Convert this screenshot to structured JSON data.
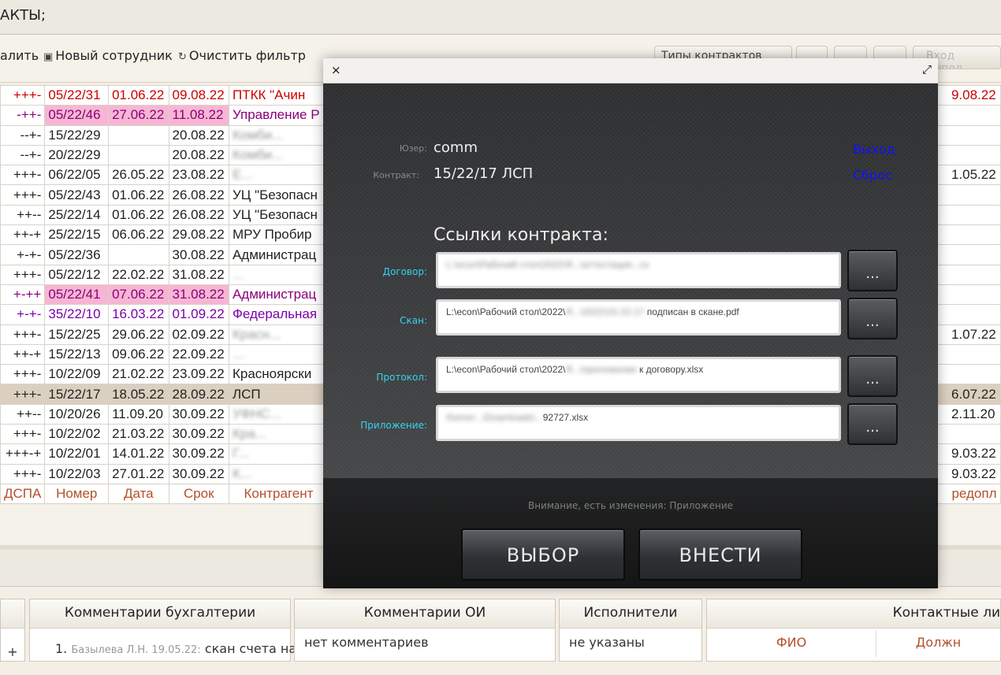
{
  "app": {
    "title": "АКТЫ;",
    "toolbar": {
      "delete_label": "алить",
      "new_employee_label": "Новый сотрудник",
      "clear_filter_label": "Очистить фильтр",
      "contract_types_label": "Типы контрактов",
      "login_label": "Вход выпол"
    },
    "grid": {
      "rows": [
        {
          "flags": "+++-",
          "num": "05/22/31",
          "date": "01.06.22",
          "term": "09.08.22",
          "party": "ПТКК \"Ачин",
          "right": "9.08.22",
          "style": "red"
        },
        {
          "flags": "-++-",
          "num": "05/22/46",
          "date": "27.06.22",
          "term": "11.08.22",
          "party": "Управление Р",
          "right": "",
          "style": "pink"
        },
        {
          "flags": "--+-",
          "num": "15/22/29",
          "date": "",
          "term": "20.08.22",
          "party": "Комби...",
          "right": "",
          "style": ""
        },
        {
          "flags": "--+-",
          "num": "20/22/29",
          "date": "",
          "term": "20.08.22",
          "party": "Комби...",
          "right": "",
          "style": ""
        },
        {
          "flags": "+++-",
          "num": "06/22/05",
          "date": "26.05.22",
          "term": "23.08.22",
          "party": "Е...",
          "right": "1.05.22",
          "style": ""
        },
        {
          "flags": "+++-",
          "num": "05/22/43",
          "date": "01.06.22",
          "term": "26.08.22",
          "party": "УЦ \"Безопасн",
          "right": "",
          "style": ""
        },
        {
          "flags": "++--",
          "num": "25/22/14",
          "date": "01.06.22",
          "term": "26.08.22",
          "party": "УЦ \"Безопасн",
          "right": "",
          "style": ""
        },
        {
          "flags": "++-+",
          "num": "25/22/15",
          "date": "06.06.22",
          "term": "29.08.22",
          "party": "МРУ Пробир",
          "right": "",
          "style": ""
        },
        {
          "flags": "+-+-",
          "num": "05/22/36",
          "date": "",
          "term": "30.08.22",
          "party": "Администрац",
          "right": "",
          "style": ""
        },
        {
          "flags": "+++-",
          "num": "05/22/12",
          "date": "22.02.22",
          "term": "31.08.22",
          "party": "...",
          "right": "",
          "style": ""
        },
        {
          "flags": "+-++",
          "num": "05/22/41",
          "date": "07.06.22",
          "term": "31.08.22",
          "party": "Администрац",
          "right": "",
          "style": "pink"
        },
        {
          "flags": "+-+-",
          "num": "35/22/10",
          "date": "16.03.22",
          "term": "01.09.22",
          "party": "Федеральная",
          "right": "",
          "style": "purple"
        },
        {
          "flags": "+++-",
          "num": "15/22/25",
          "date": "29.06.22",
          "term": "02.09.22",
          "party": "Красн...",
          "right": "1.07.22",
          "style": ""
        },
        {
          "flags": "++-+",
          "num": "15/22/13",
          "date": "09.06.22",
          "term": "22.09.22",
          "party": "...",
          "right": "",
          "style": ""
        },
        {
          "flags": "+++-",
          "num": "10/22/09",
          "date": "21.02.22",
          "term": "23.09.22",
          "party": "Красноярски",
          "right": "",
          "style": ""
        },
        {
          "flags": "+++-",
          "num": "15/22/17",
          "date": "18.05.22",
          "term": "28.09.22",
          "party": "ЛСП",
          "right": "6.07.22",
          "style": "sel"
        },
        {
          "flags": "++--",
          "num": "10/20/26",
          "date": "11.09.20",
          "term": "30.09.22",
          "party": "УФНС...",
          "right": "2.11.20",
          "style": ""
        },
        {
          "flags": "+++-",
          "num": "10/22/02",
          "date": "21.03.22",
          "term": "30.09.22",
          "party": "Кра...",
          "right": "",
          "style": ""
        },
        {
          "flags": "+++-+",
          "num": "10/22/01",
          "date": "14.01.22",
          "term": "30.09.22",
          "party": "Г...",
          "right": "9.03.22",
          "style": ""
        },
        {
          "flags": "+++-",
          "num": "10/22/03",
          "date": "27.01.22",
          "term": "30.09.22",
          "party": "К...",
          "right": "9.03.22",
          "style": ""
        }
      ],
      "headers": {
        "flags": "ДСПА",
        "num": "Номер",
        "date": "Дата",
        "term": "Срок",
        "party": "Контрагент",
        "right": "редопл"
      }
    },
    "bottom_panels": {
      "accounting": {
        "title": "Комментарии бухгалтерии",
        "item_num": "1.",
        "item_author": "Базылева Л.Н. 19.05.22:",
        "item_text": "скан счета на"
      },
      "oi": {
        "title": "Комментарии ОИ",
        "text": "нет комментариев"
      },
      "executors": {
        "title": "Исполнители",
        "text": "не указаны"
      },
      "contacts": {
        "title": "Контактные ли",
        "col_fio": "ФИО",
        "col_pos": "Должн"
      },
      "left_plus": "+"
    }
  },
  "modal": {
    "user_label": "Юзер:",
    "user_value": "comm",
    "contract_label": "Контракт:",
    "contract_value": "15/22/17 ЛСП",
    "exit_link": "Выход",
    "reset_link": "Сброс",
    "links_title": "Ссылки контракта:",
    "rows": [
      {
        "label": "Договор:",
        "path": "L:\\econ\\Рабочий стол\\2022\\Я...\\аттестация...сх",
        "dots": "..."
      },
      {
        "label": "Скан:",
        "path_visible": "L:\\econ\\Рабочий стол\\2022\\",
        "path_hidden": "Я...\\2022\\15-22-17 ",
        "path_end": "подписан в скане.pdf",
        "dots": "..."
      },
      {
        "label": "Протокол:",
        "path_visible": "L:\\econ\\Рабочий стол\\2022\\",
        "path_hidden": "Я...\\приложение",
        "path_end": " к договору.xlsx",
        "dots": "..."
      },
      {
        "label": "Приложение:",
        "path_hidden": "/home/...\\Downloads\\...",
        "path_end": "92727.xlsx",
        "dots": "..."
      }
    ],
    "warning": "Внимание, есть изменения: Приложение",
    "select_button": "ВЫБОР",
    "submit_button": "ВНЕСТИ",
    "close_glyph": "×",
    "expand_glyph": "⤢"
  }
}
